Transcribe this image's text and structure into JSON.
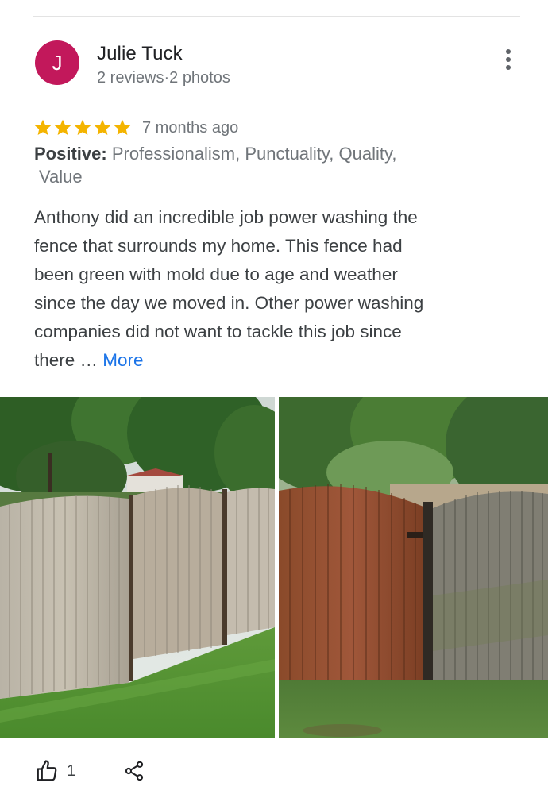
{
  "reviewer": {
    "initial": "J",
    "name": "Julie Tuck",
    "meta": "2 reviews·2 photos"
  },
  "rating": {
    "stars": 5,
    "time_ago": "7 months ago"
  },
  "positive": {
    "label": "Positive:",
    "line1": " Professionalism, Punctuality, Quality,",
    "line2": "Value"
  },
  "review": {
    "lines": [
      "Anthony did an incredible job power washing the",
      "fence that surrounds my home.  This fence had",
      "been green with mold due to age and weather",
      "since the day we moved in. Other power washing",
      "companies did not want to tackle this job since",
      "there … "
    ],
    "more_label": "More"
  },
  "actions": {
    "like_count": "1"
  },
  "colors": {
    "avatar": "#c2185b",
    "star": "#f4b400",
    "link": "#1a73e8"
  },
  "icons": [
    "more-vert-icon",
    "star-icon",
    "thumb-up-icon",
    "share-icon"
  ]
}
